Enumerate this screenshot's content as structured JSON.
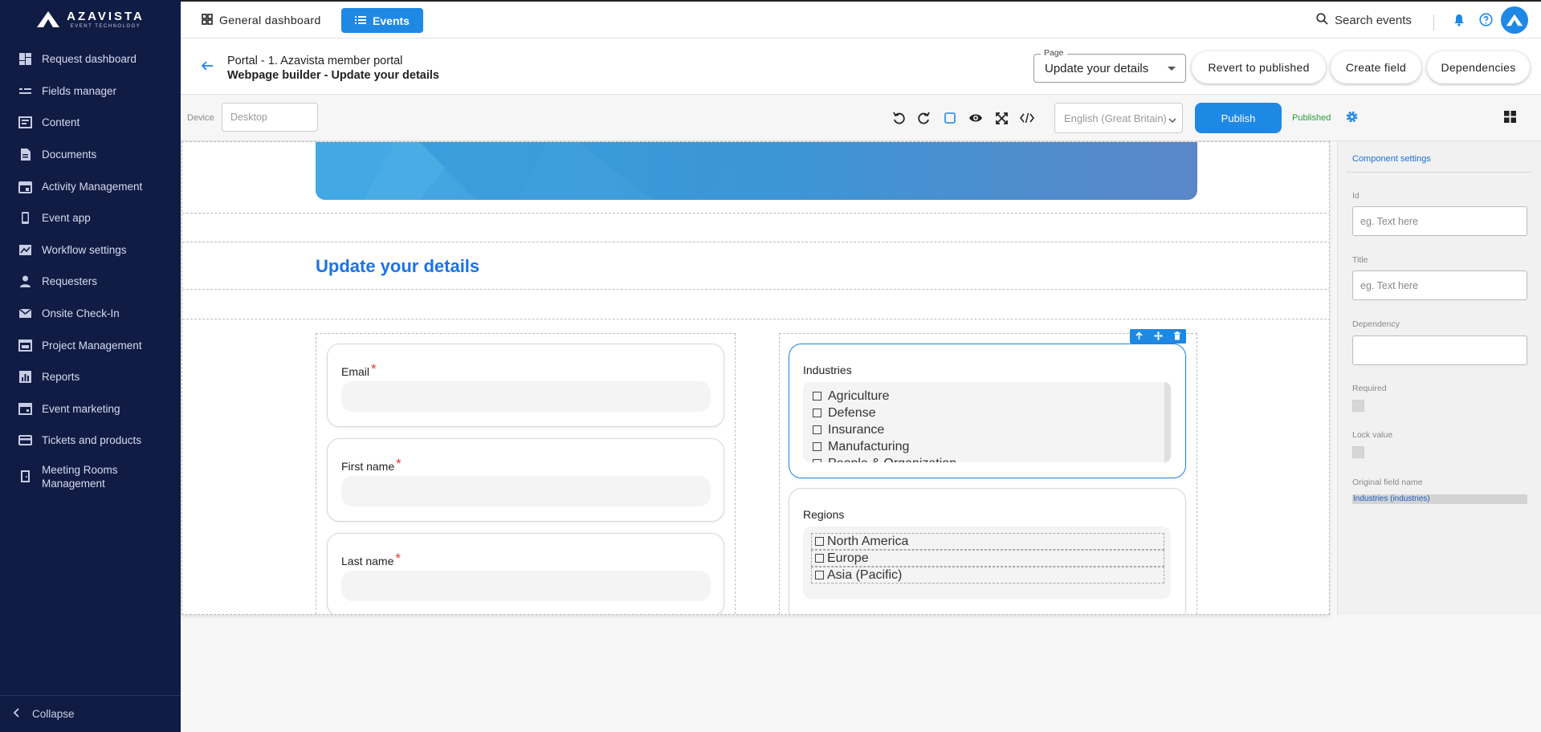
{
  "brand": {
    "name": "AZAVISTA",
    "tagline": "EVENT TECHNOLOGY"
  },
  "sidebar": {
    "items": [
      {
        "label": "Request dashboard",
        "icon": "dashboard-icon"
      },
      {
        "label": "Fields manager",
        "icon": "fields-icon"
      },
      {
        "label": "Content",
        "icon": "content-icon"
      },
      {
        "label": "Documents",
        "icon": "document-icon"
      },
      {
        "label": "Activity Management",
        "icon": "calendar-icon"
      },
      {
        "label": "Event app",
        "icon": "phone-icon"
      },
      {
        "label": "Workflow settings",
        "icon": "workflow-icon"
      },
      {
        "label": "Requesters",
        "icon": "person-icon"
      },
      {
        "label": "Onsite Check-In",
        "icon": "mail-icon"
      },
      {
        "label": "Project Management",
        "icon": "project-icon"
      },
      {
        "label": "Reports",
        "icon": "reports-icon"
      },
      {
        "label": "Event marketing",
        "icon": "marketing-icon"
      },
      {
        "label": "Tickets and products",
        "icon": "card-icon"
      },
      {
        "label": "Meeting Rooms Management",
        "icon": "room-icon"
      }
    ],
    "collapse_label": "Collapse"
  },
  "topbar": {
    "general_dashboard": "General dashboard",
    "events": "Events",
    "search_placeholder": "Search events"
  },
  "header": {
    "breadcrumb": "Portal - 1. Azavista member portal",
    "title": "Webpage builder - Update your details",
    "page_select_label": "Page",
    "page_select_value": "Update your details",
    "revert": "Revert to published",
    "create_field": "Create field",
    "dependencies": "Dependencies"
  },
  "toolbar": {
    "device_label": "Device",
    "device_value": "Desktop",
    "language": "English (Great Britain)",
    "publish": "Publish",
    "status": "Published"
  },
  "canvas": {
    "page_title": "Update your details",
    "fields_left": [
      {
        "label": "Email",
        "required": "*"
      },
      {
        "label": "First name",
        "required": "*"
      },
      {
        "label": "Last name",
        "required": "*"
      }
    ],
    "industries": {
      "label": "Industries",
      "options": [
        "Agriculture",
        "Defense",
        "Insurance",
        "Manufacturing",
        "People & Organization"
      ]
    },
    "regions": {
      "label": "Regions",
      "options": [
        "North America",
        "Europe",
        "Asia (Pacific)"
      ]
    }
  },
  "panel": {
    "title": "Component settings",
    "id_label": "Id",
    "id_placeholder": "eg. Text here",
    "title_label": "Title",
    "title_placeholder": "eg. Text here",
    "dependency_label": "Dependency",
    "required_label": "Required",
    "lock_label": "Lock value",
    "original_label": "Original field name",
    "original_value": "Industries (industries)"
  },
  "colors": {
    "accent": "#1e88e5",
    "sidebar": "#111c45",
    "title": "#1a73e8",
    "published": "#2e9a3a",
    "required": "#e53935"
  }
}
